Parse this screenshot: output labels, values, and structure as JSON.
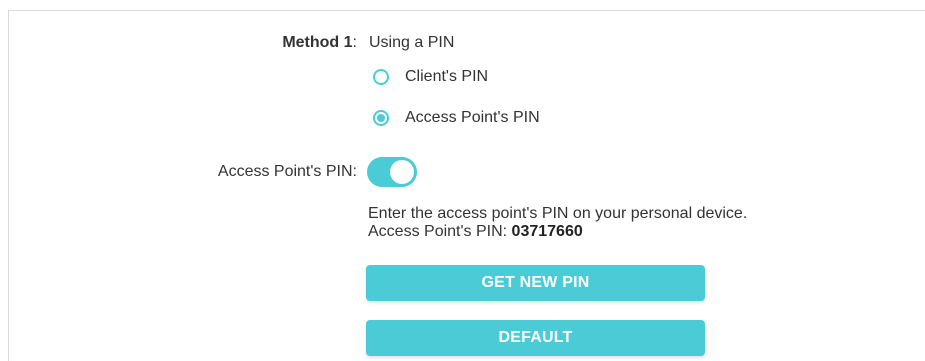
{
  "method": {
    "label": "Method 1",
    "colon": ":",
    "value": "Using a PIN"
  },
  "radios": {
    "client_pin": {
      "label": "Client's PIN",
      "selected": false
    },
    "ap_pin": {
      "label": "Access Point's PIN",
      "selected": true
    }
  },
  "ap_pin_toggle": {
    "label": "Access Point's PIN:",
    "enabled": true
  },
  "info": {
    "instruction": "Enter the access point's PIN on your personal device.",
    "pin_prefix": "Access Point's PIN: ",
    "pin_value": "03717660"
  },
  "buttons": {
    "get_new_pin": "GET NEW PIN",
    "default": "DEFAULT"
  },
  "colors": {
    "accent": "#4acbd6",
    "text": "#333333",
    "border": "#d9d9d9"
  }
}
